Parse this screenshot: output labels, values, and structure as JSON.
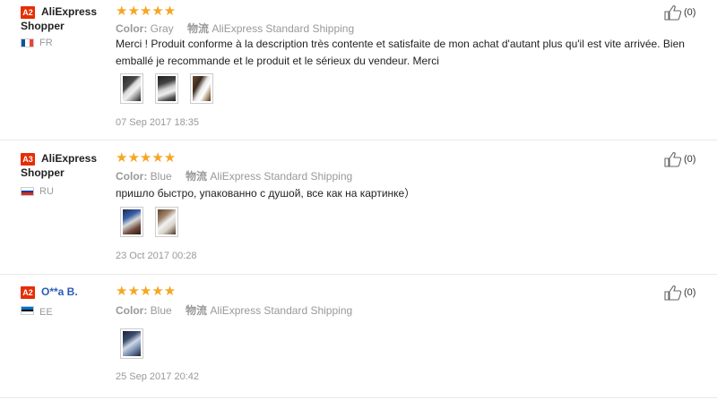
{
  "reviews": [
    {
      "level": "A2",
      "user": "AliExpress Shopper",
      "country": "FR",
      "stars": "★★★★★",
      "color_label": "Color:",
      "color_value": "Gray",
      "shipping_label": "物流",
      "shipping_value": "AliExpress Standard Shipping",
      "text": "Merci ! Produit conforme à la description très contente et satisfaite de mon achat d'autant plus qu'il est vite arrivée. Bien emballé je recommande et le produit et le sérieux du vendeur. Merci",
      "date": "07 Sep 2017 18:35",
      "helpful": "(0)"
    },
    {
      "level": "A3",
      "user": "AliExpress Shopper",
      "country": "RU",
      "stars": "★★★★★",
      "color_label": "Color:",
      "color_value": "Blue",
      "shipping_label": "物流",
      "shipping_value": "AliExpress Standard Shipping",
      "text": "пришло быстро, упакованно с душой, все как на картинке）",
      "date": "23 Oct 2017 00:28",
      "helpful": "(0)"
    },
    {
      "level": "A2",
      "user": "O**a B.",
      "country": "EE",
      "stars": "★★★★★",
      "color_label": "Color:",
      "color_value": "Blue",
      "shipping_label": "物流",
      "shipping_value": "AliExpress Standard Shipping",
      "text": "",
      "date": "25 Sep 2017 20:42",
      "helpful": "(0)"
    }
  ],
  "colors": {
    "badge": "#e62e04",
    "star": "#f5a623",
    "link": "#2a5cb8"
  },
  "icons": {
    "helpful": "thumbs-up-icon"
  }
}
